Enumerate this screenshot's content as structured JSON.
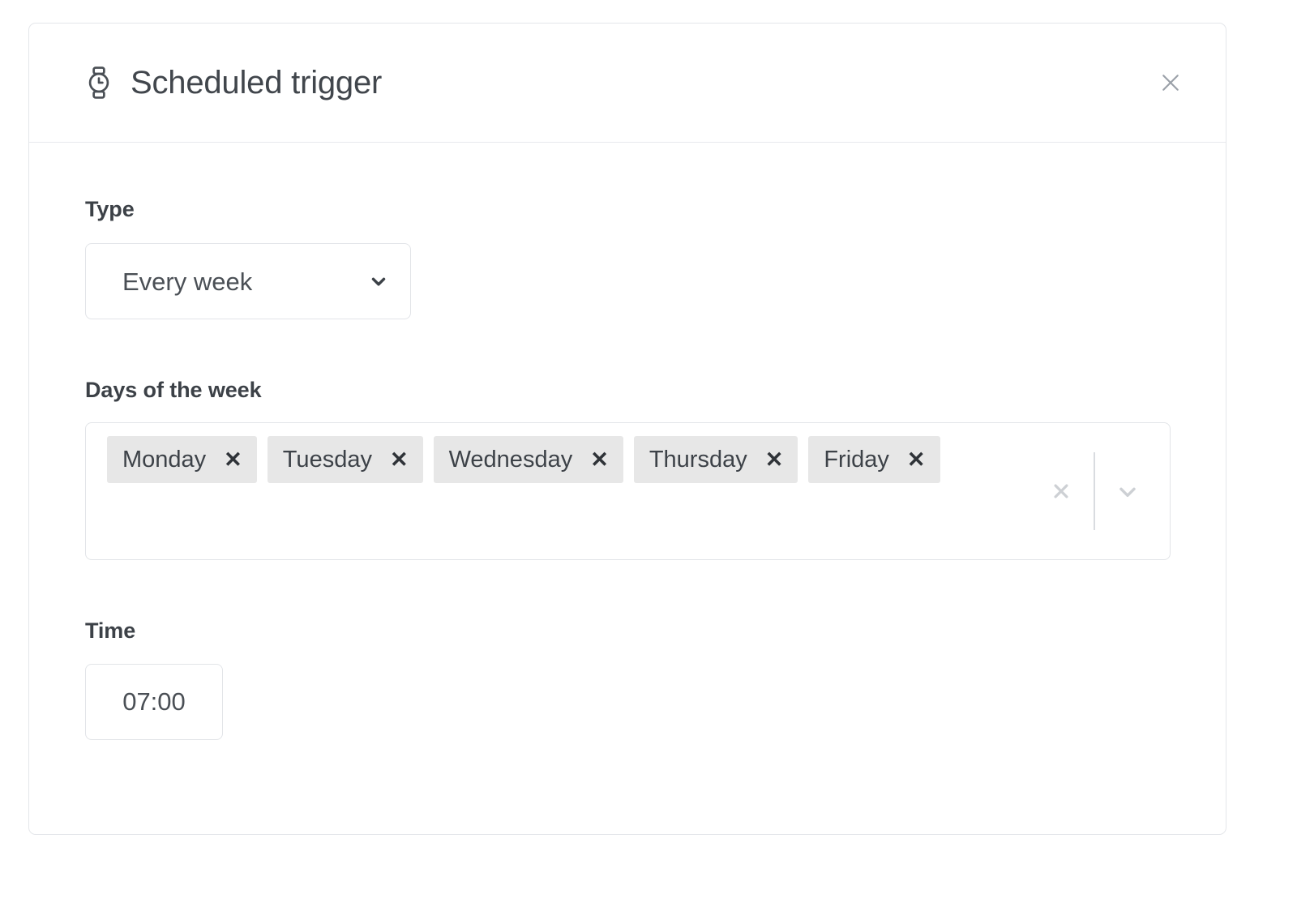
{
  "panel": {
    "title": "Scheduled trigger",
    "icon": "watch-icon",
    "close_label": "×"
  },
  "type_field": {
    "label": "Type",
    "value": "Every week",
    "options": [
      "Every week"
    ],
    "chevron": "chevron-down-icon"
  },
  "days_field": {
    "label": "Days of the week",
    "tags": [
      {
        "label": "Monday",
        "remove": "✕"
      },
      {
        "label": "Tuesday",
        "remove": "✕"
      },
      {
        "label": "Wednesday",
        "remove": "✕"
      },
      {
        "label": "Thursday",
        "remove": "✕"
      },
      {
        "label": "Friday",
        "remove": "✕"
      }
    ],
    "clear_icon": "clear-all-icon",
    "dropdown_icon": "chevron-down-icon"
  },
  "time_field": {
    "label": "Time",
    "value": "07:00",
    "placeholder": "--:--"
  },
  "colors": {
    "card_border": "#e4e6ea",
    "text_primary": "#3c4147",
    "text_secondary": "#4a4f55",
    "tag_background": "#e7e7e7",
    "indicator": "#cdd0d4",
    "input_border": "#e2e4e8"
  }
}
